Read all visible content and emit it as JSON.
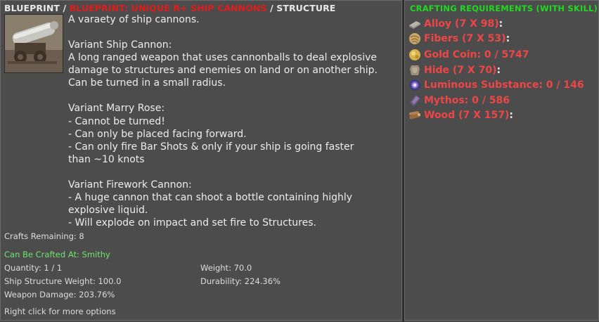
{
  "breadcrumb": {
    "part1": "BLUEPRINT",
    "sep": "/",
    "part2": "BLUEPRINT: UNIQUE R+ SHIP CANNONS",
    "part3": "STRUCTURE"
  },
  "description": {
    "lines": [
      "A varaety of ship cannons.",
      "",
      "Variant Ship Cannon:",
      "A long ranged weapon that uses cannonballs to deal explosive",
      "damage to structures and enemies on land or on another ship.",
      "Can be turned in a small radius.",
      "",
      "Variant Marry Rose:",
      "- Cannot be turned!",
      "- Can only be placed facing forward.",
      "- Can only fire Bar Shots & only if your ship is going faster",
      "than ~10 knots",
      "",
      "Variant Firework Cannon:",
      "- A huge cannon that can shoot a bottle containing highly",
      "explosive liquid.",
      "- Will explode on impact and set fire to Structures."
    ]
  },
  "stats": {
    "crafts_remaining": "Crafts Remaining: 8",
    "crafted_at": "Can Be Crafted At: Smithy",
    "quantity": "Quantity: 1 / 1",
    "weight": "Weight: 70.0",
    "ship_structure_weight": "Ship Structure Weight: 100.0",
    "durability": "Durability: 224.36%",
    "weapon_damage": "Weapon Damage: 203.76%",
    "hint": "Right click for more options"
  },
  "requirements": {
    "title": "CRAFTING REQUIREMENTS (WITH SKILL)",
    "items": [
      {
        "label": "Alloy (7 X 98)",
        "suffix": ":",
        "icon": "alloy-icon"
      },
      {
        "label": "Fibers (7 X 53)",
        "suffix": ":",
        "icon": "fibers-icon"
      },
      {
        "label": "Gold Coin: 0 / 5747",
        "suffix": "",
        "icon": "gold-coin-icon"
      },
      {
        "label": "Hide (7 X 70)",
        "suffix": ":",
        "icon": "hide-icon"
      },
      {
        "label": "Luminous Substance: 0 / 146",
        "suffix": "",
        "icon": "luminous-substance-icon"
      },
      {
        "label": "Mythos: 0 / 586",
        "suffix": "",
        "icon": "mythos-icon"
      },
      {
        "label": "Wood (7 X 157)",
        "suffix": ":",
        "icon": "wood-icon"
      }
    ]
  },
  "colors": {
    "background": "#4c4c4c",
    "breadcrumb_highlight": "#e21b1b",
    "crafted_at": "#6fe36f",
    "requirements_title": "#20d820",
    "requirement_missing": "#ee4646"
  }
}
